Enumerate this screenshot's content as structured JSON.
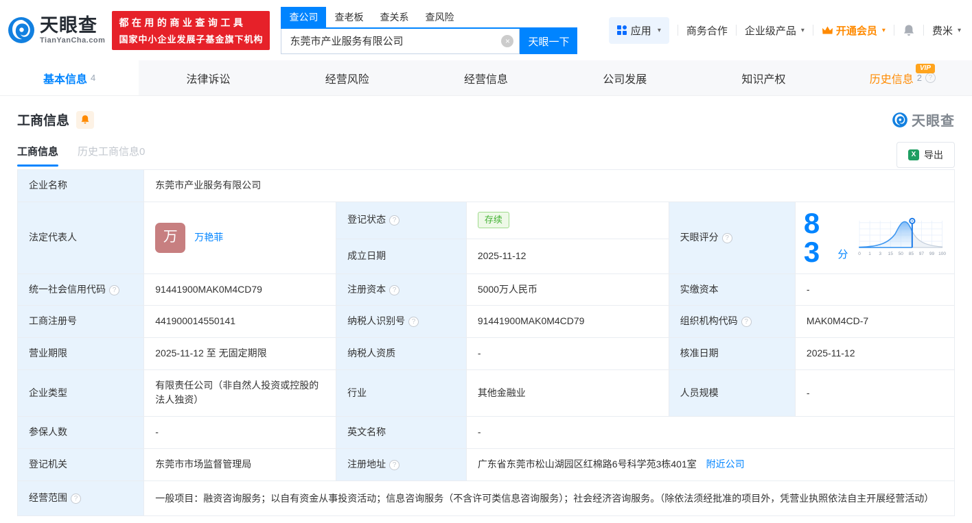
{
  "header": {
    "logo": {
      "brand": "天眼查",
      "domain": "TianYanCha.com"
    },
    "slogan": {
      "line1": "都在用的商业查询工具",
      "line2": "国家中小企业发展子基金旗下机构"
    },
    "search": {
      "tabs": [
        {
          "label": "查公司"
        },
        {
          "label": "查老板"
        },
        {
          "label": "查关系"
        },
        {
          "label": "查风险"
        }
      ],
      "value": "东莞市产业服务有限公司",
      "clear": "×",
      "button": "天眼一下"
    },
    "menu": {
      "apps": "应用",
      "cooperation": "商务合作",
      "enterprise": "企业级产品",
      "vip": "开通会员",
      "username": "费米",
      "caret": "▾"
    }
  },
  "nav": {
    "tabs": [
      {
        "label": "基本信息",
        "count": "4"
      },
      {
        "label": "法律诉讼"
      },
      {
        "label": "经营风险"
      },
      {
        "label": "经营信息"
      },
      {
        "label": "公司发展"
      },
      {
        "label": "知识产权"
      },
      {
        "label": "历史信息",
        "count": "2",
        "badge": "VIP",
        "help": "?"
      }
    ]
  },
  "section": {
    "title": "工商信息",
    "watermark": "天眼查",
    "subtabs": [
      {
        "label": "工商信息"
      },
      {
        "label": "历史工商信息0"
      }
    ],
    "export_label": "导出",
    "export_icon": "X"
  },
  "fields": {
    "company_name": {
      "label": "企业名称",
      "value": "东莞市产业服务有限公司"
    },
    "legal_rep": {
      "label": "法定代表人",
      "value": "万艳菲",
      "avatar": "万"
    },
    "reg_status": {
      "label": "登记状态",
      "value": "存续"
    },
    "establish_date": {
      "label": "成立日期",
      "value": "2025-11-12"
    },
    "score": {
      "label": "天眼评分",
      "value": "83",
      "unit": "分"
    },
    "credit_code": {
      "label": "统一社会信用代码",
      "value": "91441900MAK0M4CD79"
    },
    "reg_capital": {
      "label": "注册资本",
      "value": "5000万人民币"
    },
    "paid_capital": {
      "label": "实缴资本",
      "value": "-"
    },
    "reg_number": {
      "label": "工商注册号",
      "value": "441900014550141"
    },
    "taxpayer_id": {
      "label": "纳税人识别号",
      "value": "91441900MAK0M4CD79"
    },
    "org_code": {
      "label": "组织机构代码",
      "value": "MAK0M4CD-7"
    },
    "business_term": {
      "label": "营业期限",
      "value": "2025-11-12 至 无固定期限"
    },
    "taxpayer_quality": {
      "label": "纳税人资质",
      "value": "-"
    },
    "approval_date": {
      "label": "核准日期",
      "value": "2025-11-12"
    },
    "company_type": {
      "label": "企业类型",
      "value": "有限责任公司（非自然人投资或控股的法人独资）"
    },
    "industry": {
      "label": "行业",
      "value": "其他金融业"
    },
    "staff_size": {
      "label": "人员规模",
      "value": "-"
    },
    "insured_count": {
      "label": "参保人数",
      "value": "-"
    },
    "english_name": {
      "label": "英文名称",
      "value": "-"
    },
    "reg_authority": {
      "label": "登记机关",
      "value": "东莞市市场监督管理局"
    },
    "reg_address": {
      "label": "注册地址",
      "value": "广东省东莞市松山湖园区红棉路6号科学苑3栋401室",
      "link": "附近公司"
    },
    "business_scope": {
      "label": "经营范围",
      "value": "一般项目：融资咨询服务；以自有资金从事投资活动；信息咨询服务（不含许可类信息咨询服务）；社会经济咨询服务。（除依法须经批准的项目外，凭营业执照依法自主开展经营活动）"
    }
  },
  "chart_data": {
    "type": "area",
    "title": "天眼评分分布曲线",
    "score": 83,
    "x_ticks": [
      "0",
      "1",
      "3",
      "15",
      "50",
      "85",
      "97",
      "99",
      "100"
    ],
    "marker_at": "85",
    "accent_color": "#0084ff",
    "tail_color": "#c3cedb"
  },
  "colors": {
    "primary": "#0084ff",
    "banner_red": "#e62129",
    "vip_orange": "#ff8a00",
    "status_green": "#44b235",
    "label_bg": "#e8f3fd"
  }
}
